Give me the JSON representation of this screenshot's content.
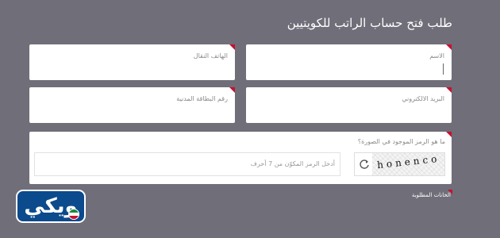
{
  "page": {
    "title": "طلب فتح حساب الراتب للكويتيين",
    "required_note": "الخانات المطلوبة"
  },
  "form": {
    "name_label": "الاسم",
    "mobile_label": "الهاتف النقال",
    "email_label": "البريد الالكتروني",
    "civil_id_label": "رقم البطاقة المدنية",
    "captcha_question": "ما هو الرمز الموجود في الصورة؟",
    "captcha_placeholder": "أدخل الرمز المكوّن من 7 أحرف",
    "captcha_text": "honenco"
  },
  "logo": {
    "text": "ويكي"
  },
  "colors": {
    "background": "#6f6e79",
    "required_marker": "#c8102e",
    "logo_blue": "#0b4a8c"
  }
}
